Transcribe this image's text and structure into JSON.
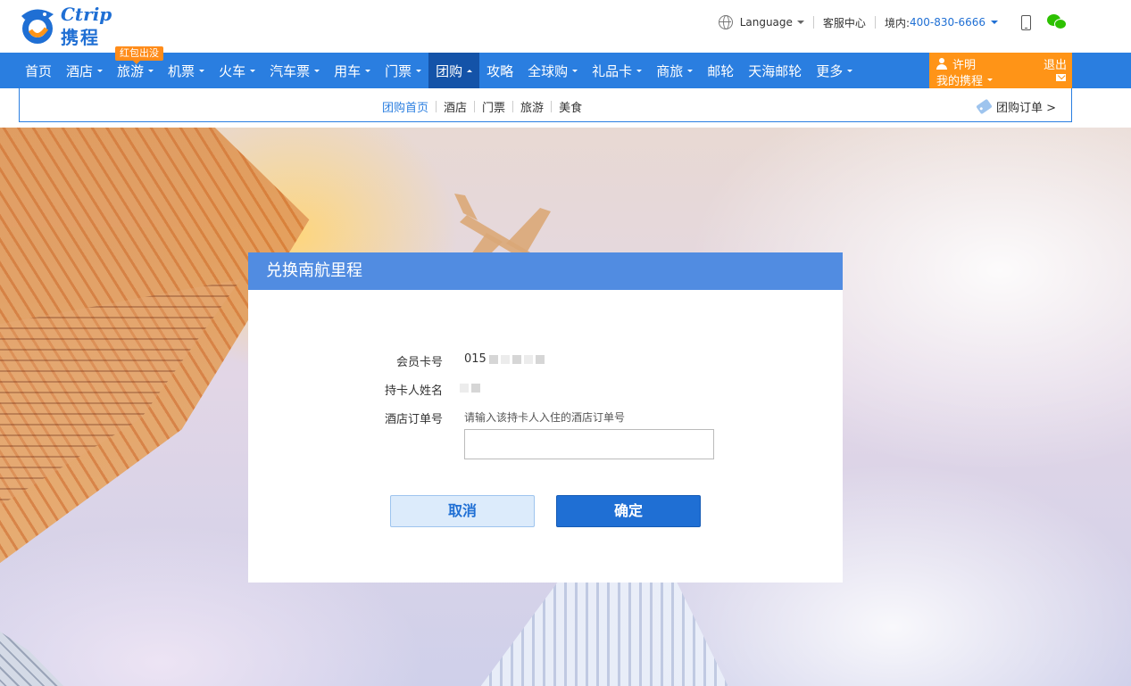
{
  "header": {
    "logo_en": "Ctrip",
    "logo_cn": "携程",
    "language_label": "Language",
    "service_center": "客服中心",
    "domestic_label": "境内:",
    "phone": "400-830-6666"
  },
  "nav": {
    "items": [
      {
        "label": "首页",
        "caret": false
      },
      {
        "label": "酒店",
        "caret": true
      },
      {
        "label": "旅游",
        "caret": true
      },
      {
        "label": "机票",
        "caret": true
      },
      {
        "label": "火车",
        "caret": true
      },
      {
        "label": "汽车票",
        "caret": true
      },
      {
        "label": "用车",
        "caret": true
      },
      {
        "label": "门票",
        "caret": true
      },
      {
        "label": "团购",
        "caret": true,
        "active": true
      },
      {
        "label": "攻略",
        "caret": false
      },
      {
        "label": "全球购",
        "caret": true
      },
      {
        "label": "礼品卡",
        "caret": true
      },
      {
        "label": "商旅",
        "caret": true
      },
      {
        "label": "邮轮",
        "caret": false
      },
      {
        "label": "天海邮轮",
        "caret": false
      },
      {
        "label": "更多",
        "caret": true
      }
    ],
    "badge": "红包出没"
  },
  "user": {
    "name": "许明",
    "my_ctrip": "我的携程",
    "logout": "退出"
  },
  "subnav": {
    "items": [
      "团购首页",
      "酒店",
      "门票",
      "旅游",
      "美食"
    ],
    "group_order": "团购订单 >"
  },
  "dialog": {
    "title": "兑换南航里程",
    "card_no_label": "会员卡号",
    "card_no_value": "015",
    "holder_label": "持卡人姓名",
    "order_label": "酒店订单号",
    "order_hint": "请输入该持卡人入住的酒店订单号",
    "order_value": "",
    "cancel": "取消",
    "confirm": "确定"
  },
  "colors": {
    "brand_blue": "#2a7ee0",
    "active_nav": "#1453a8",
    "user_orange": "#ff9417",
    "confirm_blue": "#1f6fd4"
  }
}
